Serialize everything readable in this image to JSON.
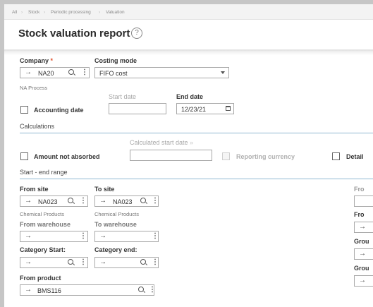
{
  "breadcrumb": [
    "All",
    "Stock",
    "Periodic processing",
    "Valuation"
  ],
  "page_title": "Stock valuation report",
  "help_icon": "?",
  "company": {
    "label": "Company",
    "required_mark": "*",
    "value": "NA20",
    "description": "NA Process"
  },
  "costing_mode": {
    "label": "Costing mode",
    "value": "FIFO cost"
  },
  "accounting_date": {
    "label": "Accounting date"
  },
  "start_date": {
    "label": "Start date",
    "value": ""
  },
  "end_date": {
    "label": "End date",
    "value": "12/23/21"
  },
  "calculations": {
    "label": "Calculations"
  },
  "amount_not_absorbed": {
    "label": "Amount not absorbed"
  },
  "calculated_start_date": {
    "label": "Calculated start date",
    "suffix": "»",
    "value": ""
  },
  "reporting_currency": {
    "label": "Reporting currency"
  },
  "detail": {
    "label": "Detail"
  },
  "range": {
    "label": "Start - end range"
  },
  "from_site": {
    "label": "From site",
    "value": "NA023",
    "description": "Chemical Products"
  },
  "to_site": {
    "label": "To site",
    "value": "NA023",
    "description": "Chemical Products"
  },
  "from_warehouse": {
    "label": "From warehouse",
    "value": ""
  },
  "to_warehouse": {
    "label": "To warehouse",
    "value": ""
  },
  "category_start": {
    "label": "Category Start:",
    "value": ""
  },
  "category_end": {
    "label": "Category end:",
    "value": ""
  },
  "from_product": {
    "label": "From product",
    "value": "BMS116"
  },
  "right_column": [
    "Fro",
    "Fro",
    "Grou",
    "Grou"
  ],
  "icons": {
    "arrow": "→",
    "more": "⋮",
    "search": "search-icon",
    "calendar": "calendar-icon",
    "caret": "chevron-down-icon"
  }
}
